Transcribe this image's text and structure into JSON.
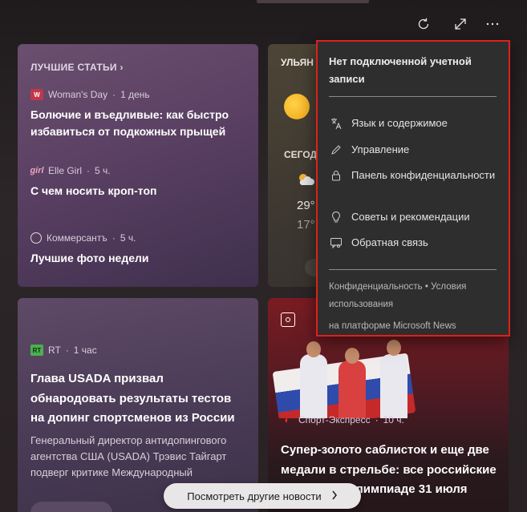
{
  "toolbar": {
    "refresh_icon": "refresh-icon",
    "expand_icon": "expand-icon",
    "more_icon": "more-icon"
  },
  "top_stories": {
    "title": "ЛУЧШИЕ СТАТЬИ",
    "items": [
      {
        "source": "Woman's Day",
        "age": "1 день",
        "headline": "Болючие и въедливые: как быстро избавиться от подкожных прыщей"
      },
      {
        "source": "Elle Girl",
        "age": "5 ч.",
        "headline": "С чем носить кроп-топ"
      },
      {
        "source": "Коммерсантъ",
        "age": "5 ч.",
        "headline": "Лучшие фото недели"
      }
    ]
  },
  "weather": {
    "city": "УЛЬЯН",
    "today": "СЕГОД",
    "high": "29°",
    "low": "17°"
  },
  "rt_card": {
    "source": "RT",
    "age": "1 час",
    "headline": "Глава USADA призвал обнародовать результаты тестов на допинг спортсменов из России",
    "description": "Генеральный директор антидопингового агентства США (USADA) Трэвис Тайгарт подверг критике Международный"
  },
  "sport_card": {
    "source": "Спорт-Экспресс",
    "age": "10 ч.",
    "headline": "Супер-золото саблисток и еще две медали в стрельбе: все российские медали на Олимпиаде 31 июля"
  },
  "more_news": {
    "label": "Посмотреть другие новости"
  },
  "menu": {
    "header": "Нет подключенной учетной записи",
    "items": [
      {
        "label": "Язык и содержимое"
      },
      {
        "label": "Управление"
      },
      {
        "label": "Панель конфиденциальности"
      },
      {
        "label": "Советы и рекомендации"
      },
      {
        "label": "Обратная связь"
      }
    ],
    "privacy": "Конфиденциальность",
    "bullet": "•",
    "terms": "Условия использования",
    "powered": "на платформе Microsoft News"
  },
  "colors": {
    "menu_border": "#e0201a",
    "rt_logo": "#4caf50",
    "sport_logo": "#e62e2e"
  }
}
